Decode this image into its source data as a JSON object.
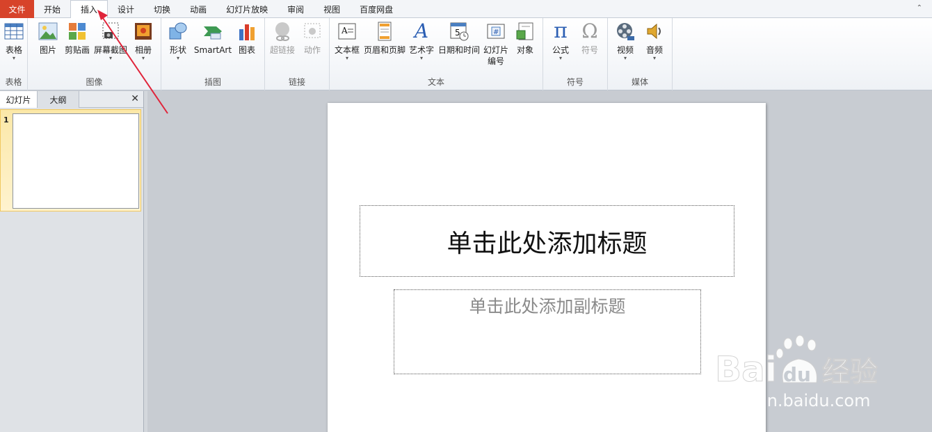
{
  "tabs": {
    "file": "文件",
    "items": [
      "开始",
      "插入",
      "设计",
      "切换",
      "动画",
      "幻灯片放映",
      "审阅",
      "视图",
      "百度网盘"
    ],
    "active": "插入"
  },
  "ribbon": {
    "groups": {
      "table": "表格",
      "image": "图像",
      "illustration": "插图",
      "link": "链接",
      "text": "文本",
      "symbol": "符号",
      "media": "媒体"
    },
    "commands": {
      "table": "表格",
      "picture": "图片",
      "clipart": "剪贴画",
      "screenshot": "屏幕截图",
      "album": "相册",
      "shapes": "形状",
      "smartart": "SmartArt",
      "chart": "图表",
      "hyperlink": "超链接",
      "action": "动作",
      "textbox": "文本框",
      "header_footer": "页眉和页脚",
      "wordart": "艺术字",
      "datetime": "日期和时间",
      "slide_number_1": "幻灯片",
      "slide_number_2": "编号",
      "object": "对象",
      "equation": "公式",
      "symbol": "符号",
      "video": "视频",
      "audio": "音频"
    },
    "icon_glyphs": {
      "pi": "π",
      "omega": "Ω",
      "wordart": "A",
      "datetime_num": "5",
      "slide_num": "#"
    }
  },
  "left_panel": {
    "tab_slides": "幻灯片",
    "tab_outline": "大纲",
    "close": "✕",
    "thumb_number": "1"
  },
  "slide": {
    "title_placeholder": "单击此处添加标题",
    "subtitle_placeholder": "单击此处添加副标题"
  },
  "watermark": {
    "brand_a": "Bai",
    "brand_b": "du",
    "brand_c": "经验",
    "url": "jingyan.baidu.com"
  },
  "colors": {
    "file_tab": "#d7432a",
    "arrow": "#e0243a",
    "ribbon_bg": "#f4f6f9"
  }
}
